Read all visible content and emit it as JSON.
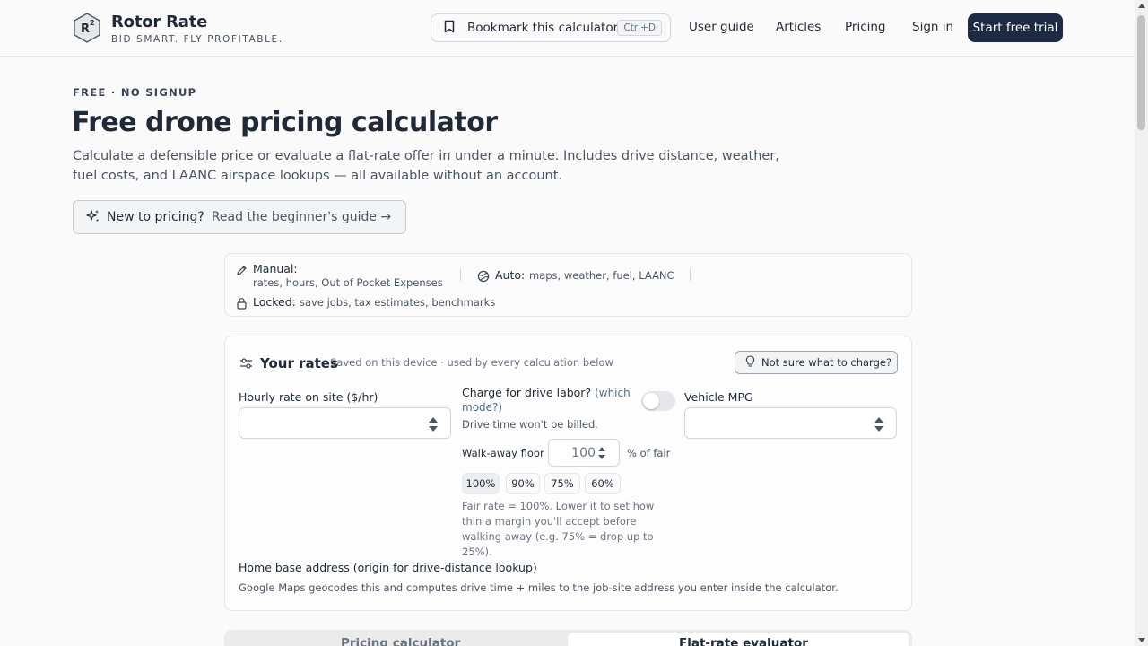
{
  "brand": {
    "name": "Rotor Rate",
    "tagline": "BID SMART. FLY PROFITABLE.",
    "logo_text": "R",
    "logo_sup": "2"
  },
  "header": {
    "bookmark_label": "Bookmark this calculator",
    "bookmark_shortcut": "Ctrl+D",
    "nav": {
      "user_guide": "User guide",
      "articles": "Articles",
      "pricing": "Pricing",
      "sign_in": "Sign in"
    },
    "cta_label": "Start free trial"
  },
  "hero": {
    "eyebrow": "FREE · NO SIGNUP",
    "title": "Free drone pricing calculator",
    "description": "Calculate a defensible price or evaluate a flat-rate offer in under a minute. Includes drive distance, weather, fuel costs, and LAANC airspace lookups — all available without an account.",
    "guide_strong": "New to pricing?",
    "guide_link": "Read the beginner's guide →"
  },
  "modes": {
    "manual_label": "Manual:",
    "manual_desc": "rates, hours, Out of Pocket Expenses",
    "auto_label": "Auto:",
    "auto_desc": "maps, weather, fuel, LAANC",
    "locked_label": "Locked:",
    "locked_desc": "save jobs, tax estimates, benchmarks"
  },
  "rates": {
    "title": "Your rates",
    "subtitle": "Saved on this device · used by every calculation below",
    "not_sure_label": "Not sure what to charge?",
    "hourly_label": "Hourly rate on site ($/hr)",
    "hourly_value": "",
    "drive_label": "Charge for drive labor?",
    "drive_mode_link": "(which mode?)",
    "drive_toggle_on": false,
    "drive_note": "Drive time won't be billed.",
    "walk_label": "Walk-away floor",
    "walk_value": "100",
    "walk_unit": "% of fair",
    "percent_options": [
      "100%",
      "90%",
      "75%",
      "60%"
    ],
    "percent_selected": "100%",
    "fair_note": "Fair rate = 100%. Lower it to set how thin a margin you'll accept before walking away (e.g. 75% = drop up to 25%).",
    "mpg_label": "Vehicle MPG",
    "mpg_value": "",
    "home_label": "Home base address (origin for drive-distance lookup)",
    "home_note": "Google Maps geocodes this and computes drive time + miles to the job-site address you enter inside the calculator."
  },
  "tabs": {
    "pricing": "Pricing calculator",
    "flat_rate": "Flat-rate evaluator",
    "active": "flat_rate"
  },
  "colors": {
    "brand_dark": "#1e2a44",
    "link": "#4b6d8f"
  }
}
